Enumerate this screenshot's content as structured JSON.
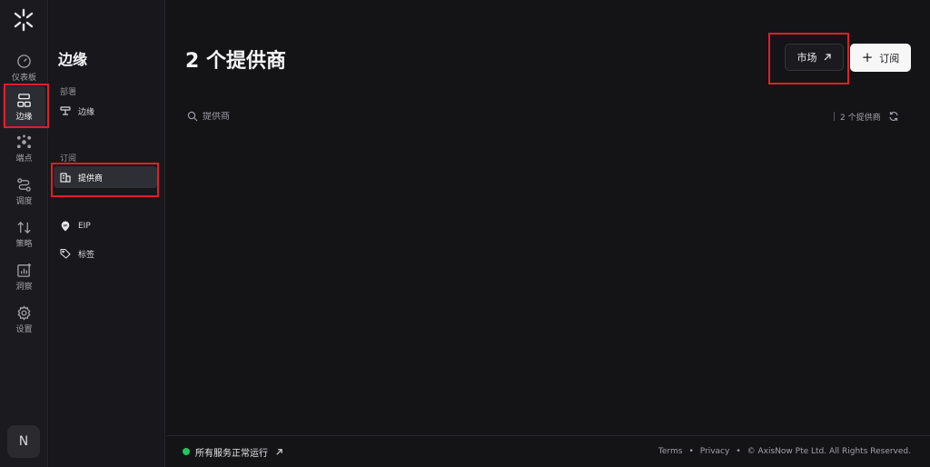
{
  "rail": {
    "items": [
      {
        "label": "仪表板",
        "icon": "gauge-icon"
      },
      {
        "label": "边缘",
        "icon": "edge-icon"
      },
      {
        "label": "端点",
        "icon": "endpoints-icon"
      },
      {
        "label": "调度",
        "icon": "routing-icon"
      },
      {
        "label": "策略",
        "icon": "policy-icon"
      },
      {
        "label": "洞察",
        "icon": "insights-icon"
      },
      {
        "label": "设置",
        "icon": "gear-icon"
      }
    ],
    "active_index": 1,
    "avatar": "N"
  },
  "subnav": {
    "title": "边缘",
    "sections": [
      {
        "label": "部署",
        "items": [
          {
            "label": "边缘",
            "icon": "edge-item-icon"
          }
        ]
      },
      {
        "label": "订阅",
        "items": [
          {
            "label": "提供商",
            "icon": "building-icon",
            "active": true
          }
        ]
      }
    ],
    "extra_items": [
      {
        "label": "EIP",
        "icon": "ip-pin-icon"
      },
      {
        "label": "标签",
        "icon": "tag-icon"
      }
    ]
  },
  "main": {
    "title": "2 个提供商",
    "market_label": "市场",
    "subscribe_label": "订阅",
    "search_placeholder": "提供商",
    "count_label": "2 个提供商"
  },
  "footer": {
    "status": "所有服务正常运行",
    "terms": "Terms",
    "privacy": "Privacy",
    "copyright": "© AxisNow Pte Ltd. All Rights Reserved."
  },
  "colors": {
    "background": "#141417",
    "highlight": "#e11d2a",
    "status_ok": "#22c55e"
  }
}
